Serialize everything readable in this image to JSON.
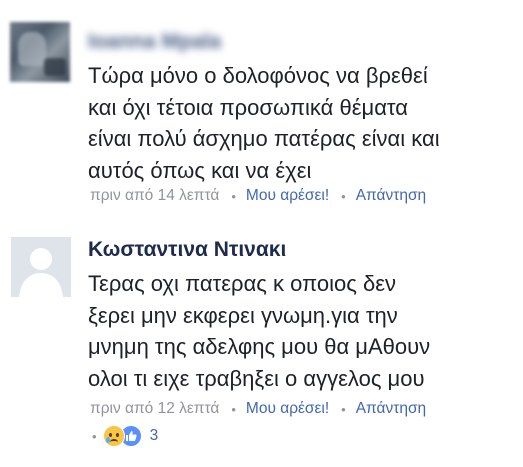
{
  "comments": [
    {
      "author": "Ioanna Mpala",
      "lines": [
        "Τώρα μόνο ο δολοφόνος να βρεθεί",
        "και όχι τέτοια προσωπικά θέματα",
        "είναι πολύ άσχημο πατέρας είναι και",
        "αυτός όπως και να έχει"
      ],
      "time": "πριν από 14 λεπτά",
      "like_label": "Μου αρέσει!",
      "reply_label": "Απάντηση"
    },
    {
      "author": "Κωσταντινα Ντινακι",
      "lines": [
        "Τερας οχι πατερας κ οποιος δεν",
        "ξερει μην εκφερει γνωμη.για την",
        "μνημη της αδελφης μου θα μΑθουν",
        "ολοι τι ειχε τραβηξει ο αγγελος μου"
      ],
      "time": "πριν από 12 λεπτά",
      "like_label": "Μου αρέσει!",
      "reply_label": "Απάντηση",
      "reactions": {
        "icons": [
          "sad-reaction-icon",
          "like-reaction-icon"
        ],
        "count": "3"
      }
    }
  ],
  "colors": {
    "link": "#4267b2",
    "meta": "#90949c",
    "author": "#365899",
    "text": "#1d2129"
  }
}
